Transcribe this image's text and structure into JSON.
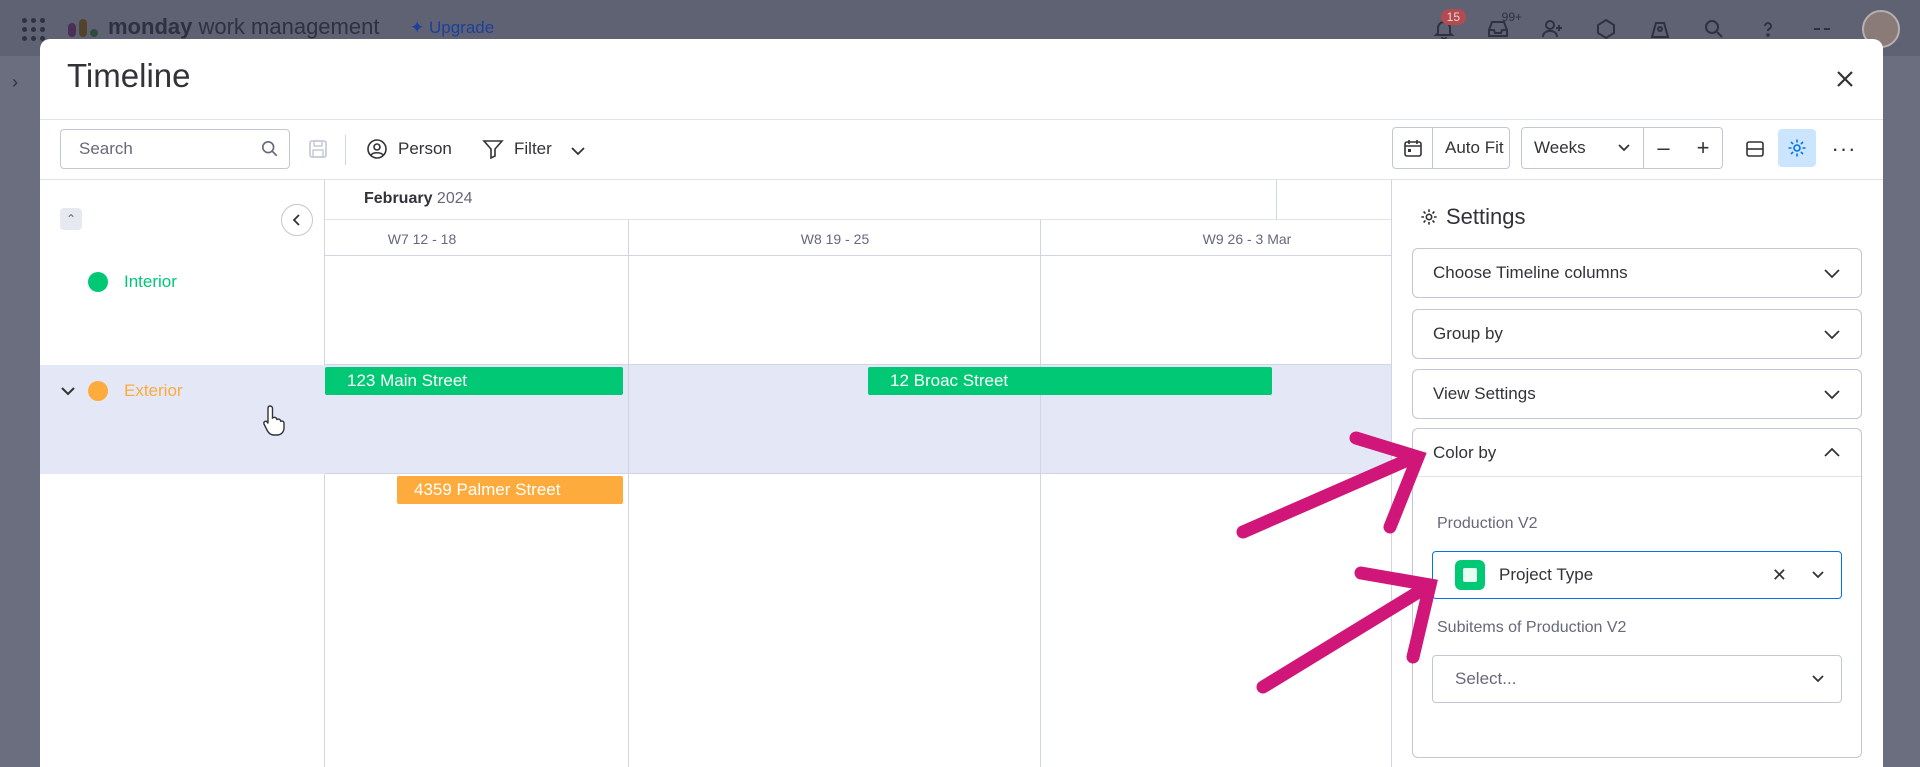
{
  "topbar": {
    "brand_bold": "monday",
    "brand_rest": " work management",
    "upgrade_label": "Upgrade",
    "notifications_badge": "15",
    "inbox_badge": "99+",
    "icons": [
      "apps-grid-icon",
      "bell-icon",
      "inbox-icon",
      "invite-icon",
      "integrations-icon",
      "marketplace-icon",
      "search-icon",
      "help-icon",
      "avatar"
    ]
  },
  "modal": {
    "title": "Timeline"
  },
  "toolbar": {
    "search_placeholder": "Search",
    "person_label": "Person",
    "filter_label": "Filter",
    "auto_fit_label": "Auto Fit",
    "scale_value": "Weeks",
    "zoom_out": "–",
    "zoom_in": "+",
    "more": "···"
  },
  "timeline": {
    "month": "February",
    "year": " 2024",
    "weeks": [
      "W7 12 - 18",
      "W8 19 - 25",
      "W9 26 - 3 Mar"
    ],
    "groups": [
      {
        "name": "Interior",
        "color": "#00c875",
        "items": [
          {
            "label": "123 Main Street",
            "color": "#00c875"
          },
          {
            "label": "12 Broac Street",
            "color": "#00c875"
          }
        ]
      },
      {
        "name": "Exterior",
        "color": "#fdab3d",
        "items": [
          {
            "label": "4359 Palmer Street",
            "color": "#fdab3d"
          }
        ]
      }
    ]
  },
  "settings": {
    "title": "Settings",
    "sections": [
      "Choose Timeline columns",
      "Group by",
      "View Settings",
      "Color by"
    ],
    "color_by": {
      "board_label": "Production V2",
      "board_value": "Project Type",
      "subitems_label": "Subitems of Production V2",
      "subitems_placeholder": "Select..."
    }
  },
  "colors": {
    "accent": "#0073ea",
    "annotation_arrow": "#d1167a",
    "selected_row": "#e4e7f5",
    "gear_active": "#cce5ff"
  }
}
